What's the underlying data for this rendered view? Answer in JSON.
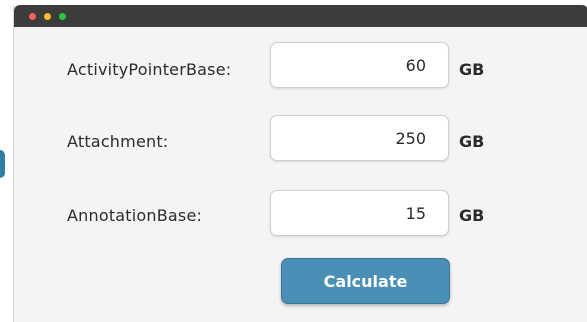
{
  "window": {
    "controls": [
      "close",
      "minimize",
      "maximize"
    ]
  },
  "form": {
    "rows": [
      {
        "label": "ActivityPointerBase:",
        "value": "60",
        "unit": "GB"
      },
      {
        "label": "Attachment:",
        "value": "250",
        "unit": "GB"
      },
      {
        "label": "AnnotationBase:",
        "value": "15",
        "unit": "GB"
      }
    ],
    "calculate_label": "Calculate"
  },
  "colors": {
    "titlebar": "#3c3c3c",
    "button": "#4a8fb5",
    "close": "#ff5f57",
    "minimize": "#febc2e",
    "maximize": "#28c840"
  }
}
